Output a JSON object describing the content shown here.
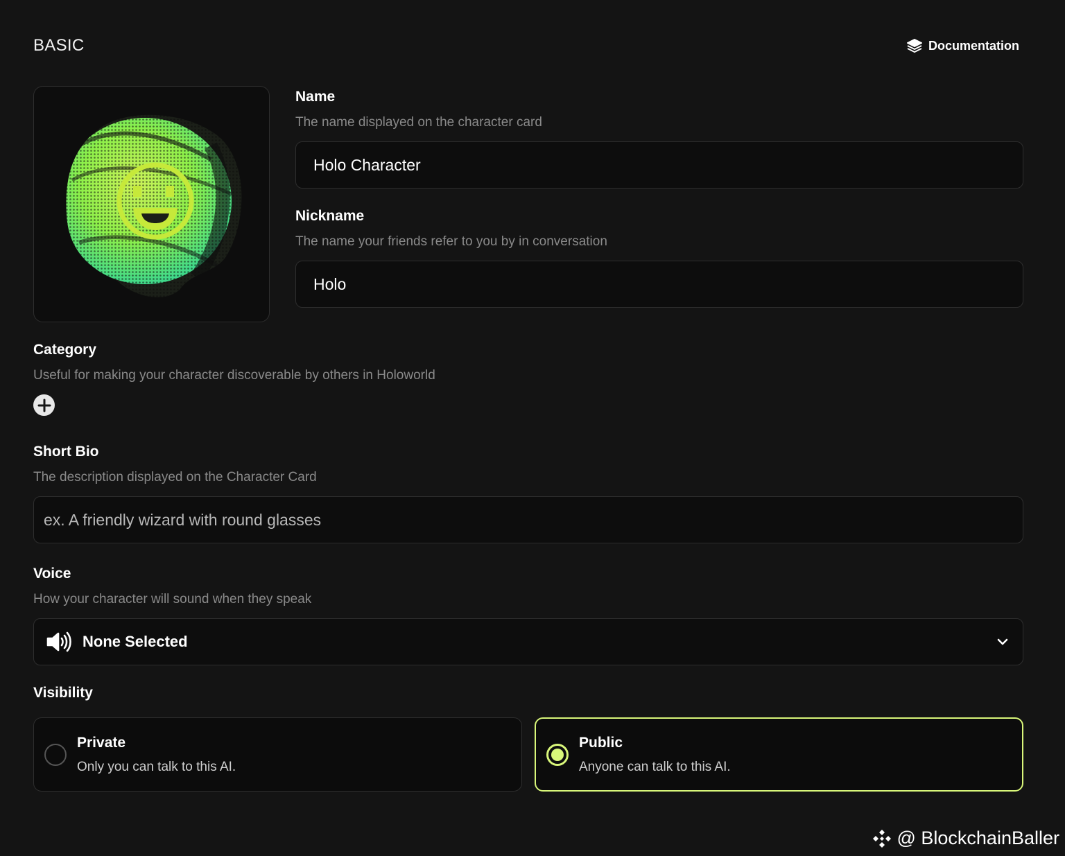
{
  "header": {
    "section_title": "BASIC",
    "documentation_label": "Documentation"
  },
  "name_field": {
    "label": "Name",
    "hint": "The name displayed on the character card",
    "value": "Holo Character"
  },
  "nickname_field": {
    "label": "Nickname",
    "hint": "The name your friends refer to you by in conversation",
    "value": "Holo"
  },
  "category_field": {
    "label": "Category",
    "hint": "Useful for making your character discoverable by others in Holoworld"
  },
  "bio_field": {
    "label": "Short Bio",
    "hint": "The description displayed on the Character Card",
    "placeholder": "ex. A friendly wizard with round glasses"
  },
  "voice_field": {
    "label": "Voice",
    "hint": "How your character will sound when they speak",
    "selected": "None Selected"
  },
  "visibility": {
    "label": "Visibility",
    "selected": "public",
    "options": [
      {
        "id": "private",
        "title": "Private",
        "description": "Only you can talk to this AI."
      },
      {
        "id": "public",
        "title": "Public",
        "description": "Anyone can talk to this AI."
      }
    ]
  },
  "watermark": {
    "text": "@ BlockchainBaller"
  },
  "colors": {
    "background": "#141414",
    "accent": "#d9f77a",
    "avatar_green": "#8ef04a"
  }
}
